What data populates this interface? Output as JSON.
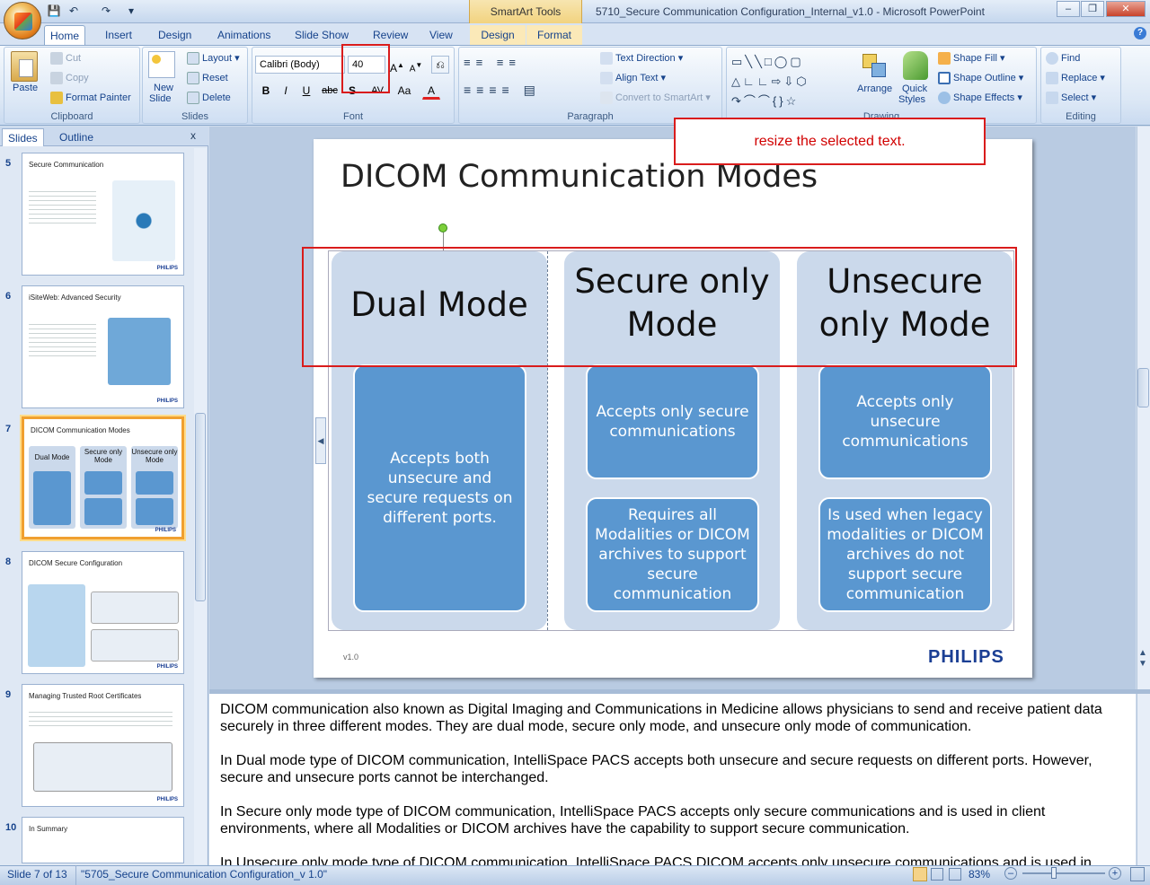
{
  "window": {
    "title": "5710_Secure Communication Configuration_Internal_v1.0 - Microsoft PowerPoint",
    "contextual_tab_group": "SmartArt Tools"
  },
  "tabs": [
    "Home",
    "Insert",
    "Design",
    "Animations",
    "Slide Show",
    "Review",
    "View",
    "Design",
    "Format"
  ],
  "ribbon": {
    "clipboard": {
      "label": "Clipboard",
      "paste": "Paste",
      "cut": "Cut",
      "copy": "Copy",
      "format_painter": "Format Painter"
    },
    "slides": {
      "label": "Slides",
      "new_slide": "New",
      "new_slide2": "Slide",
      "layout": "Layout",
      "reset": "Reset",
      "delete": "Delete"
    },
    "font": {
      "label": "Font",
      "font_name": "Calibri (Body)",
      "font_size": "40",
      "bold": "B",
      "italic": "I",
      "underline": "U",
      "strike": "abc",
      "shadow": "S",
      "spacing": "AV",
      "case": "Aa",
      "color": "A"
    },
    "paragraph": {
      "label": "Paragraph",
      "text_direction": "Text Direction",
      "align_text": "Align Text",
      "convert_smartart": "Convert to SmartArt"
    },
    "drawing": {
      "label": "Drawing",
      "arrange": "Arrange",
      "quick_styles": "Quick",
      "quick_styles2": "Styles",
      "shape_fill": "Shape Fill",
      "shape_outline": "Shape Outline",
      "shape_effects": "Shape Effects"
    },
    "editing": {
      "label": "Editing",
      "find": "Find",
      "replace": "Replace",
      "select": "Select"
    }
  },
  "pane": {
    "tab_slides": "Slides",
    "tab_outline": "Outline",
    "close": "x",
    "thumbnails": [
      {
        "num": "5",
        "title": "Secure Communication"
      },
      {
        "num": "6",
        "title": "iSiteWeb: Advanced Security"
      },
      {
        "num": "7",
        "title": "DICOM Communication Modes",
        "cols": [
          "Dual Mode",
          "Secure only Mode",
          "Unsecure only Mode"
        ]
      },
      {
        "num": "8",
        "title": "DICOM Secure Configuration"
      },
      {
        "num": "9",
        "title": "Managing Trusted Root Certificates"
      },
      {
        "num": "10",
        "title": "In Summary"
      }
    ],
    "logo": "PHILIPS"
  },
  "slide": {
    "title": "DICOM Communication Modes",
    "columns": [
      {
        "header_l1": "Dual Mode",
        "header_l2": "",
        "boxes": [
          "Accepts both unsecure and secure requests on different ports."
        ]
      },
      {
        "header_l1": "Secure only",
        "header_l2": "Mode",
        "boxes": [
          "Accepts only secure communications",
          "Requires all Modalities or DICOM archives to support secure communication"
        ]
      },
      {
        "header_l1": "Unsecure",
        "header_l2": "only Mode",
        "boxes": [
          "Accepts only unsecure communications",
          "Is used when legacy modalities or DICOM archives do not support secure communication"
        ]
      }
    ],
    "version": "v1.0",
    "logo": "PHILIPS"
  },
  "callout": "resize the selected text.",
  "notes": [
    "DICOM communication also known as Digital Imaging and Communications in Medicine allows physicians to send and receive patient data securely in three different modes. They are dual mode, secure only mode, and unsecure only mode of communication.",
    "In Dual mode type of DICOM communication, IntelliSpace PACS accepts both unsecure and secure requests on different ports. However, secure and unsecure ports cannot be interchanged.",
    "In Secure only mode type of DICOM communication, IntelliSpace PACS accepts only secure communications and is used in client environments, where all Modalities or DICOM archives have the capability to support secure communication.",
    "In Unsecure only mode type of DICOM communication, IntelliSpace PACS DICOM accepts only unsecure communications and is used in client"
  ],
  "status": {
    "slide_info": "Slide 7 of 13",
    "theme": "\"5705_Secure Communication Configuration_v 1.0\"",
    "zoom": "83%"
  }
}
